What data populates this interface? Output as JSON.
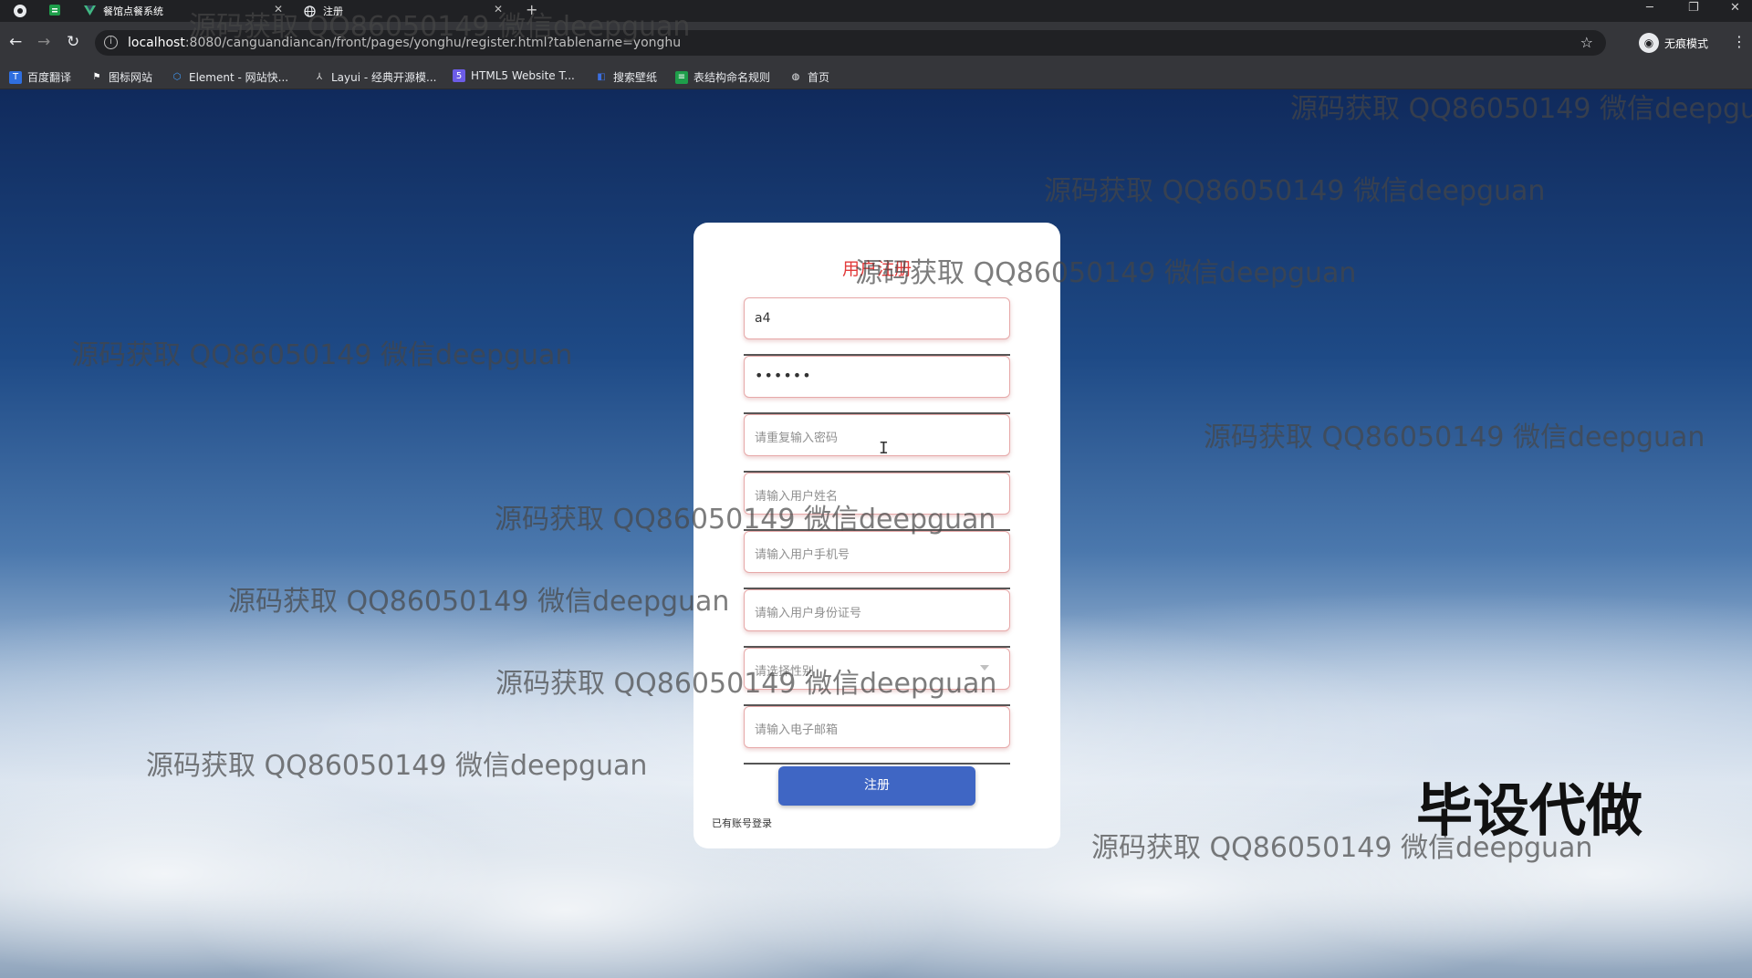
{
  "browser": {
    "tabs": [
      {
        "title": ""
      },
      {
        "title": ""
      },
      {
        "title": "餐馆点餐系统"
      },
      {
        "title": "注册"
      }
    ],
    "new_tab": "+",
    "window_controls": {
      "minimize": "─",
      "restore": "❐",
      "close": "✕"
    },
    "url_host": "localhost",
    "url_rest": ":8080/canguandiancan/front/pages/yonghu/register.html?tablename=yonghu",
    "profile_label": "无痕模式",
    "bookmarks": [
      {
        "label": "百度翻译",
        "icon": "translate-icon",
        "color": "#2f6fe0"
      },
      {
        "label": "图标网站",
        "icon": "flag-icon",
        "color": "#ffffff"
      },
      {
        "label": "Element - 网站快...",
        "icon": "element-icon",
        "color": "#409eff"
      },
      {
        "label": "Layui - 经典开源模...",
        "icon": "layui-icon",
        "color": "#dddddd"
      },
      {
        "label": "HTML5 Website T...",
        "icon": "html5-icon",
        "color": "#6c5ce7"
      },
      {
        "label": "搜索壁纸",
        "icon": "wallpaper-icon",
        "color": "#3b6fe0"
      },
      {
        "label": "表结构命名规则",
        "icon": "sheet-icon",
        "color": "#1e9e4a"
      },
      {
        "label": "首页",
        "icon": "globe-icon",
        "color": "#e8eaed"
      }
    ]
  },
  "form": {
    "title": "用户注册",
    "username_value": "a4",
    "password_value": "••••••",
    "confirm_placeholder": "请重复输入密码",
    "name_placeholder": "请输入用户姓名",
    "phone_placeholder": "请输入用户手机号",
    "idcard_placeholder": "请输入用户身份证号",
    "gender_placeholder": "请选择性别",
    "email_placeholder": "请输入电子邮箱",
    "submit_label": "注册",
    "login_link": "已有账号登录"
  },
  "watermarks": {
    "text": "源码获取 QQ86050149 微信deepguan",
    "banner": "毕设代做"
  }
}
